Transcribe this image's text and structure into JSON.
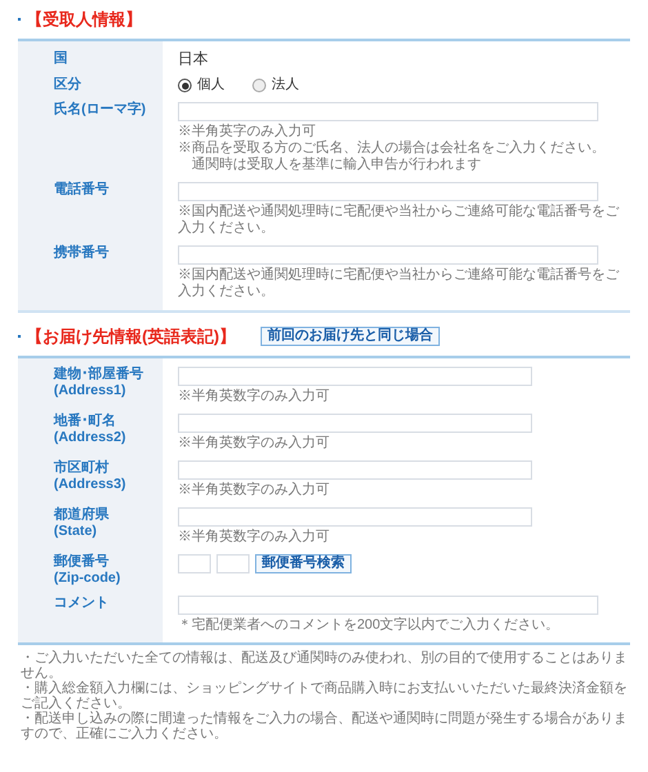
{
  "recipient": {
    "title": "【受取人情報】",
    "rows": [
      {
        "kind": "text",
        "label": "国",
        "value": "日本"
      },
      {
        "kind": "radio",
        "label": "区分",
        "options": [
          {
            "label": "個人",
            "selected": true
          },
          {
            "label": "法人",
            "selected": false
          }
        ]
      },
      {
        "kind": "input",
        "label": "氏名(ローマ字)",
        "notes": [
          "※半角英字のみ入力可",
          "※商品を受取る方のご氏名、法人の場合は会社名をご入力ください。",
          "　通関時は受取人を基準に輸入申告が行われます"
        ]
      },
      {
        "kind": "input",
        "label": "電話番号",
        "notes": [
          "※国内配送や通関処理時に宅配便や当社からご連絡可能な電話番号をご入力ください。"
        ]
      },
      {
        "kind": "input",
        "label": "携帯番号",
        "notes": [
          "※国内配送や通関処理時に宅配便や当社からご連絡可能な電話番号をご入力ください。"
        ]
      }
    ]
  },
  "delivery": {
    "title": "【お届け先情報(英語表記)】",
    "button": "前回のお届け先と同じ場合",
    "rows": [
      {
        "kind": "input",
        "label": "建物･部屋番号",
        "sublabel": "(Address1)",
        "notes": [
          "※半角英数字のみ入力可"
        ]
      },
      {
        "kind": "input",
        "label": "地番･町名",
        "sublabel": "(Address2)",
        "notes": [
          "※半角英数字のみ入力可"
        ]
      },
      {
        "kind": "input",
        "label": "市区町村",
        "sublabel": "(Address3)",
        "notes": [
          "※半角英数字のみ入力可"
        ]
      },
      {
        "kind": "input",
        "label": "都道府県",
        "sublabel": "(State)",
        "notes": [
          "※半角英数字のみ入力可"
        ]
      },
      {
        "kind": "zip",
        "label": "郵便番号",
        "sublabel": "(Zip-code)",
        "button": "郵便番号検索"
      },
      {
        "kind": "wide",
        "label": "コメント",
        "notes": [
          "＊宅配便業者へのコメントを200文字以内でご入力ください。"
        ]
      }
    ]
  },
  "footer_notes": [
    "・ご入力いただいた全ての情報は、配送及び通関時のみ使われ、別の目的で使用することはありません。",
    "・購入総金額入力欄には、ショッピングサイトで商品購入時にお支払いいただいた最終決済金額をご記入ください。",
    "・配送申し込みの際に間違った情報をご入力の場合、配送や通関時に問題が発生する場合がありますので、正確にご入力ください。"
  ]
}
